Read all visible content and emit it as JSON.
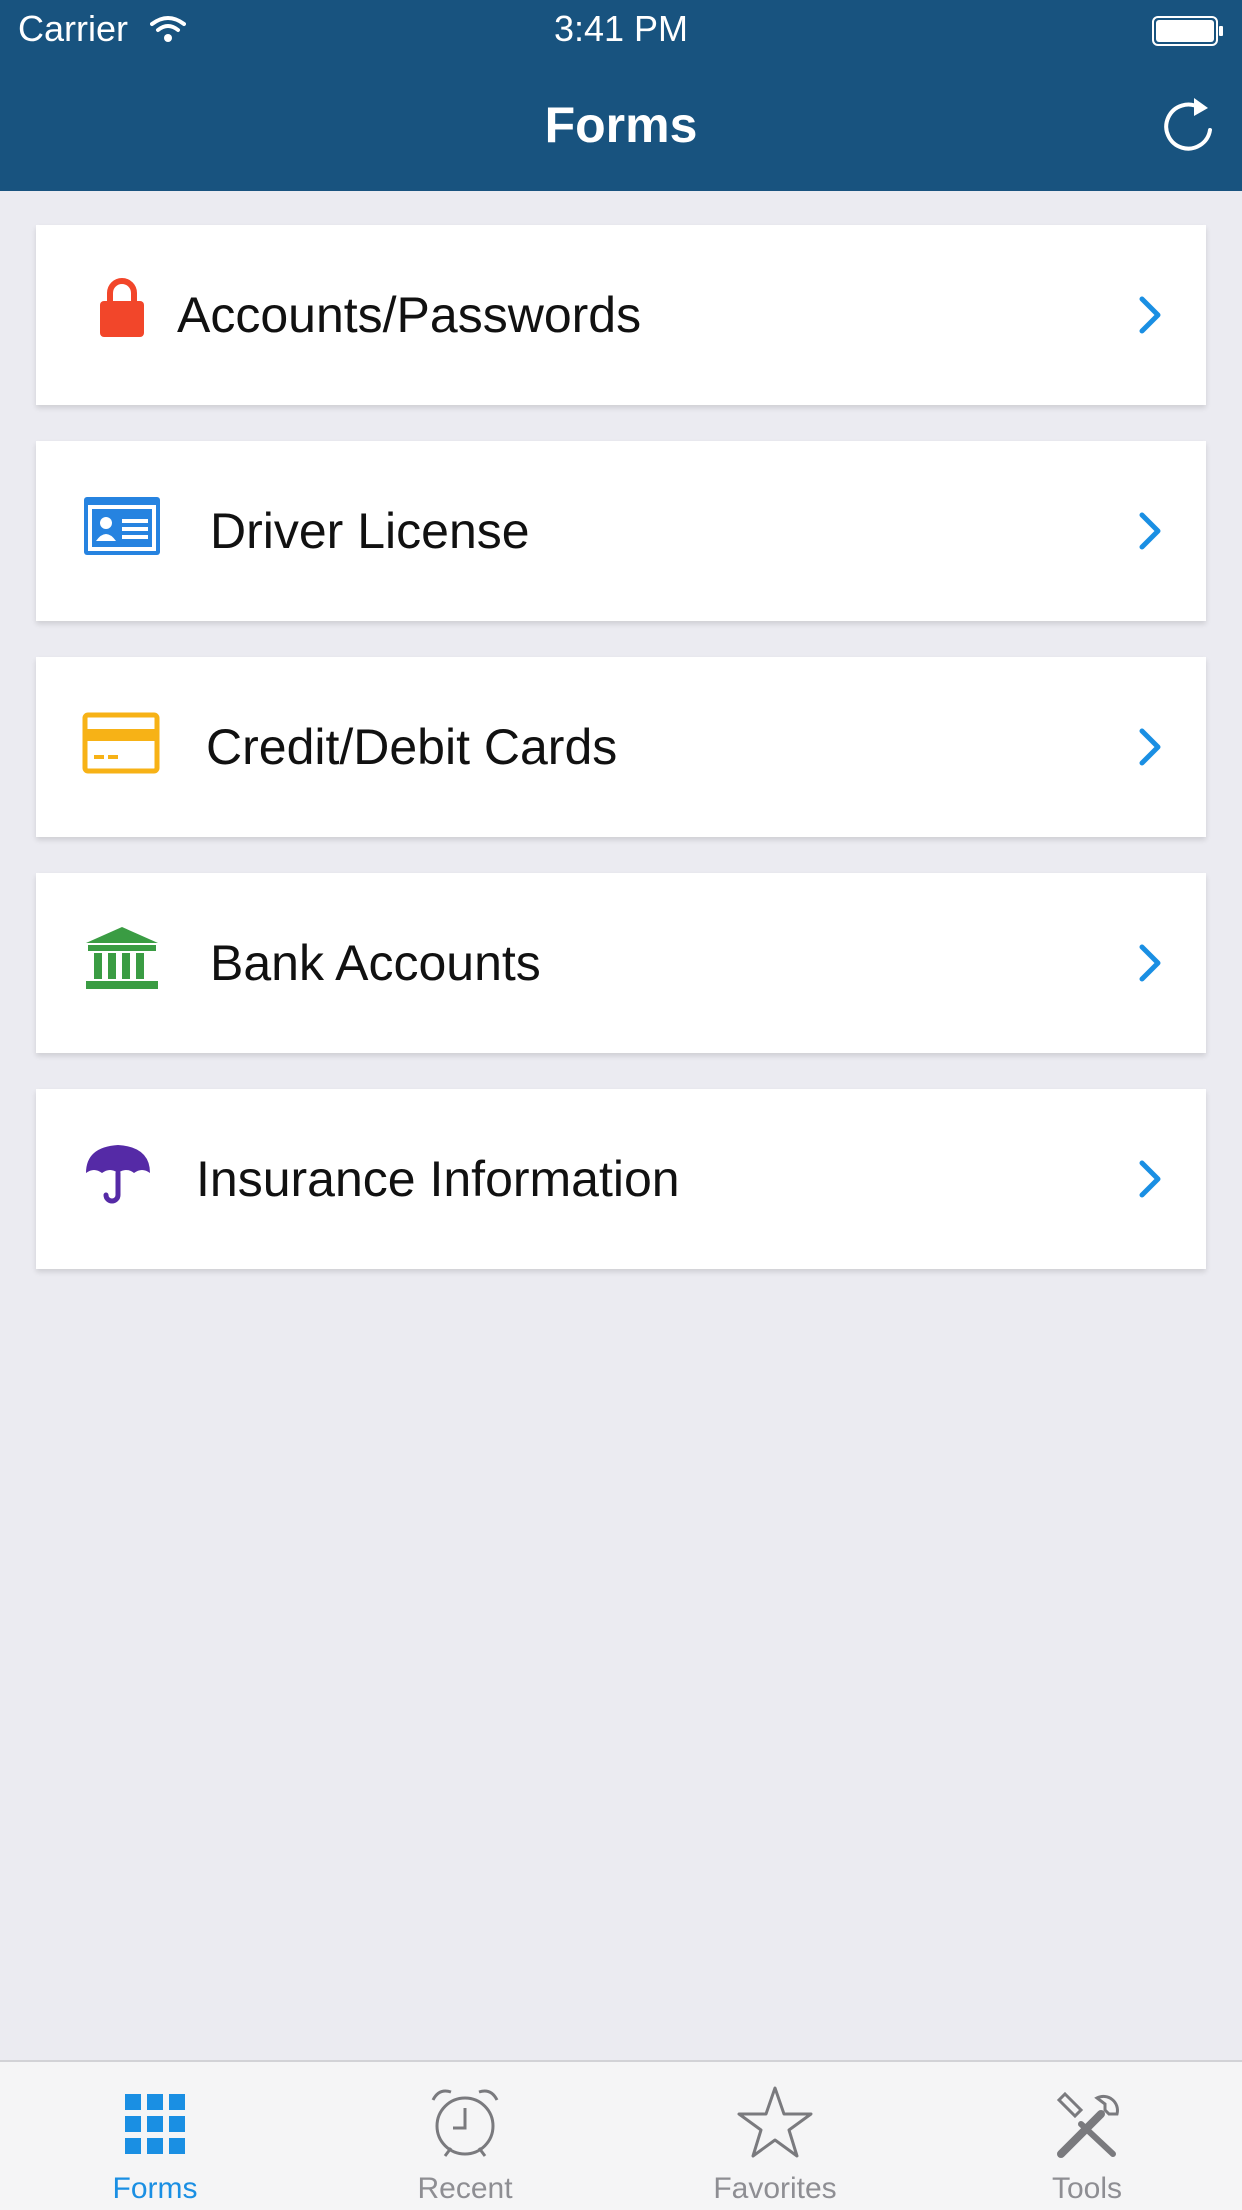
{
  "status_bar": {
    "carrier": "Carrier",
    "time": "3:41 PM"
  },
  "header": {
    "title": "Forms"
  },
  "forms": [
    {
      "label": "Accounts/Passwords",
      "icon": "lock-icon",
      "color": "#f2462a"
    },
    {
      "label": "Driver License",
      "icon": "id-card-icon",
      "color": "#2683e0"
    },
    {
      "label": "Credit/Debit Cards",
      "icon": "credit-card-icon",
      "color": "#f7b216"
    },
    {
      "label": "Bank Accounts",
      "icon": "bank-icon",
      "color": "#3a9c43"
    },
    {
      "label": "Insurance Information",
      "icon": "umbrella-icon",
      "color": "#552aa6"
    }
  ],
  "tabbar": {
    "tabs": [
      {
        "label": "Forms",
        "icon": "grid-icon",
        "active": true
      },
      {
        "label": "Recent",
        "icon": "alarm-clock-icon",
        "active": false
      },
      {
        "label": "Favorites",
        "icon": "star-icon",
        "active": false
      },
      {
        "label": "Tools",
        "icon": "tools-icon",
        "active": false
      }
    ]
  },
  "colors": {
    "nav_bar": "#18537f",
    "accent": "#1a8fe3",
    "background": "#ebebf1"
  }
}
